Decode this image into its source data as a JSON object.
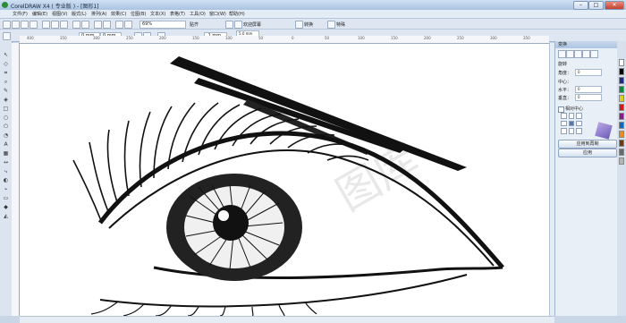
{
  "window": {
    "title": "CorelDRAW X4 ( 专业版 ) - [图形1]",
    "minimize": "–",
    "maximize": "□",
    "close": "✕"
  },
  "menu": [
    "文件(F)",
    "编辑(E)",
    "视图(V)",
    "版式(L)",
    "排列(A)",
    "效果(C)",
    "位图(B)",
    "文本(X)",
    "表格(T)",
    "工具(O)",
    "窗口(W)",
    "帮助(H)"
  ],
  "toolbar": {
    "zoom_value": "69%",
    "snap_label": "贴齐",
    "launcher_label": "欢迎屏幕",
    "convert_label": "转换",
    "spot_label": "特殊"
  },
  "property_bar": {
    "x_value": "0 mm",
    "y_value": "0 mm",
    "w_value": "5 mm",
    "h_value": "5 mm",
    "angle_value": ".1 mm",
    "nudge1": "5.0 mm",
    "nudge2": "5.0 mm"
  },
  "ruler": {
    "marks": [
      "400",
      "350",
      "300",
      "250",
      "200",
      "150",
      "100",
      "50",
      "0",
      "50",
      "100",
      "150",
      "200",
      "250",
      "300",
      "350"
    ]
  },
  "docker": {
    "title": "变换",
    "rotate_label": "旋转",
    "angle_label": "角度：",
    "angle_value": "0",
    "center_label": "中心：",
    "h_label": "水平：",
    "h_value": "0",
    "v_label": "垂直：",
    "v_value": "0",
    "relative_label": "相对中心",
    "apply_dup_label": "应用到再制",
    "apply_label": "应用"
  },
  "canvas": {
    "watermark": "图库"
  },
  "colors": {
    "accent": "#aec5e2",
    "palette": [
      "#ffffff",
      "#000000",
      "#1e2a8a",
      "#008a3a",
      "#d8d21a",
      "#d21a1a",
      "#8a1a8a",
      "#0c6ab4",
      "#f08a1a",
      "#6a3a1a",
      "#6a6a6a",
      "#b4b4b4"
    ]
  }
}
